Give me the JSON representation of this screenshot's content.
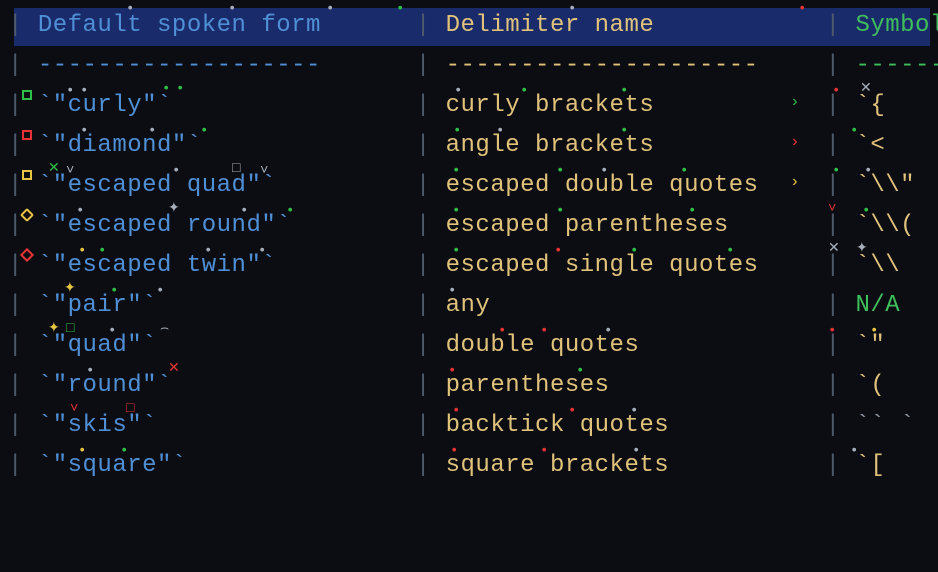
{
  "header": {
    "col1": "Default spoken form",
    "col2": "Delimiter name",
    "col3": "Symbol"
  },
  "divider": {
    "col1": "-------------------",
    "col2": "---------------------",
    "col3": "------"
  },
  "rows": [
    {
      "spoken": "`\"curly\"`",
      "name": "curly brackets",
      "symbol": "`{",
      "symClass": "yellow"
    },
    {
      "spoken": "`\"diamond\"`",
      "name": "angle brackets",
      "symbol": "`<",
      "symClass": "yellow"
    },
    {
      "spoken": "`\"escaped quad\"`",
      "name": "escaped double quotes",
      "symbol": "`\\\\\"",
      "symClass": "yellow"
    },
    {
      "spoken": "`\"escaped round\"`",
      "name": "escaped parentheses",
      "symbol": "`\\\\(",
      "symClass": "yellow"
    },
    {
      "spoken": "`\"escaped twin\"`",
      "name": "escaped single quotes",
      "symbol": "`\\\\",
      "symClass": "yellow"
    },
    {
      "spoken": "`\"pair\"`",
      "name": "any",
      "symbol": "N/A",
      "symClass": "green"
    },
    {
      "spoken": "`\"quad\"`",
      "name": "double quotes",
      "symbol": "`\"",
      "symClass": "yellow"
    },
    {
      "spoken": "`\"round\"`",
      "name": "parentheses",
      "symbol": "`(",
      "symClass": "yellow"
    },
    {
      "spoken": "`\"skis\"`",
      "name": "backtick quotes",
      "symbol": "`` `",
      "symClass": "grey"
    },
    {
      "spoken": "`\"square\"`",
      "name": "square brackets",
      "symbol": "`[",
      "symClass": "yellow"
    }
  ]
}
